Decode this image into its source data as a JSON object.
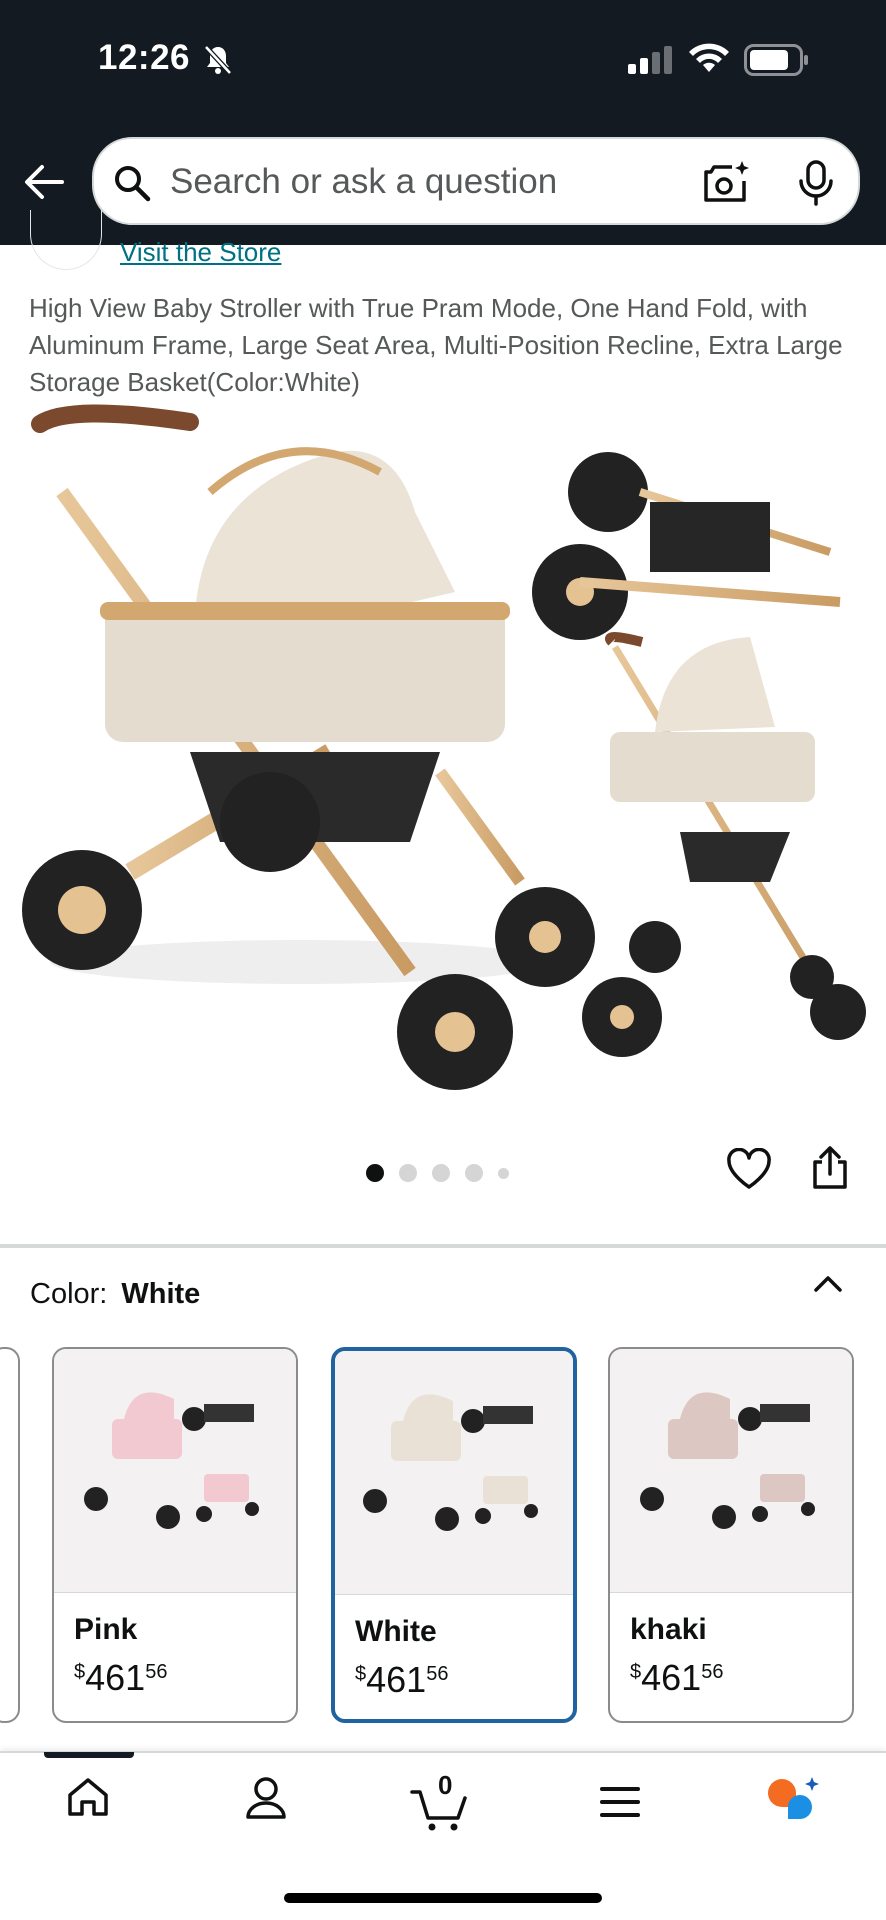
{
  "status": {
    "time": "12:26"
  },
  "search": {
    "placeholder": "Search or ask a question"
  },
  "store": {
    "visit_label": "Visit the Store"
  },
  "product": {
    "title": "High View Baby Stroller with True Pram Mode, One Hand Fold, with Aluminum Frame, Large Seat Area, Multi-Position Recline, Extra Large Storage Basket(Color:White)",
    "image_count": 5,
    "active_image": 1
  },
  "color": {
    "label": "Color:",
    "selected": "White"
  },
  "swatches": [
    {
      "name": "Pink",
      "currency": "$",
      "whole": "461",
      "fraction": "56",
      "tone": "#f2c9d1",
      "selected": false
    },
    {
      "name": "White",
      "currency": "$",
      "whole": "461",
      "fraction": "56",
      "tone": "#e9e1d6",
      "selected": true
    },
    {
      "name": "khaki",
      "currency": "$",
      "whole": "461",
      "fraction": "56",
      "tone": "#dcc7c2",
      "selected": false
    }
  ],
  "cart": {
    "count": "0"
  },
  "colors": {
    "topbar": "#131a22",
    "link": "#007185",
    "selected_border": "#2162a1"
  },
  "icons": [
    "back-arrow-icon",
    "search-icon",
    "camera-icon",
    "mic-icon",
    "heart-icon",
    "share-icon",
    "chevron-up-icon",
    "home-icon",
    "account-icon",
    "cart-icon",
    "menu-icon",
    "rufus-icon"
  ]
}
